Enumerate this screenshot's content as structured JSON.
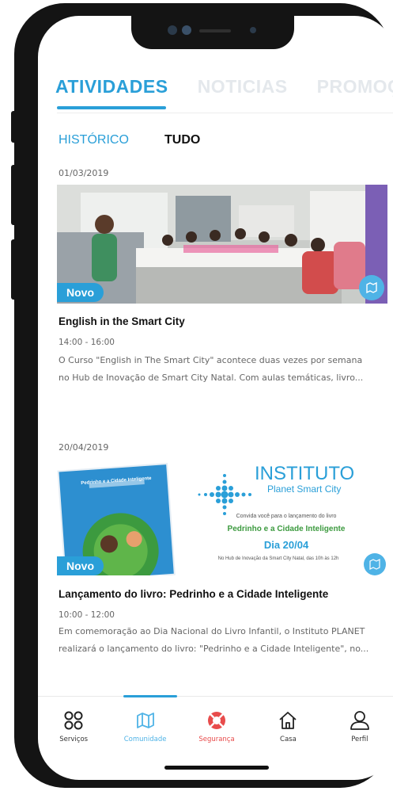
{
  "top_tabs": [
    "ATIVIDADES",
    "NOTICIAS",
    "PROMOÇ"
  ],
  "sub_tabs": [
    "HISTÓRICO",
    "TUDO"
  ],
  "cards": [
    {
      "date": "01/03/2019",
      "badge": "Novo",
      "title": "English in the Smart City",
      "time": "14:00 - 16:00",
      "description_lines": [
        "O Curso \"English in The Smart City\" acontece duas vezes por semana",
        "no Hub de Inovação de Smart City Natal. Com aulas temáticas, livro..."
      ]
    },
    {
      "date": "20/04/2019",
      "badge": "Novo",
      "title": "Lançamento do livro: Pedrinho e a Cidade Inteligente",
      "time": "10:00 - 12:00",
      "description_lines": [
        "Em comemoração ao Dia Nacional do Livro Infantil, o Instituto PLANET",
        "realizará o lançamento do livro: \"Pedrinho e a Cidade Inteligente\", no..."
      ]
    }
  ],
  "flyer": {
    "org_line1": "INSTITUTO",
    "org_line2": "Planet Smart City",
    "invite": "Convida você para o lançamento do livro",
    "book_title": "Pedrinho e a Cidade Inteligente",
    "day": "Dia 20/04",
    "location": "No Hub de Inovação da Smart City Natal, das 10h às 12h",
    "book_cover_title": "Pedrinho e a Cidade Inteligente"
  },
  "bottom_nav": [
    {
      "label": "Serviços",
      "icon": "grid-circles-icon",
      "color": "#333333"
    },
    {
      "label": "Comunidade",
      "icon": "map-icon",
      "color": "#4fb3e6"
    },
    {
      "label": "Segurança",
      "icon": "lifebuoy-icon",
      "color": "#e84c4c"
    },
    {
      "label": "Casa",
      "icon": "home-icon",
      "color": "#333333"
    },
    {
      "label": "Perfil",
      "icon": "user-icon",
      "color": "#333333"
    }
  ],
  "colors": {
    "accent": "#2a9fd8",
    "badge": "#4fb3e6",
    "safety": "#e84c4c"
  }
}
